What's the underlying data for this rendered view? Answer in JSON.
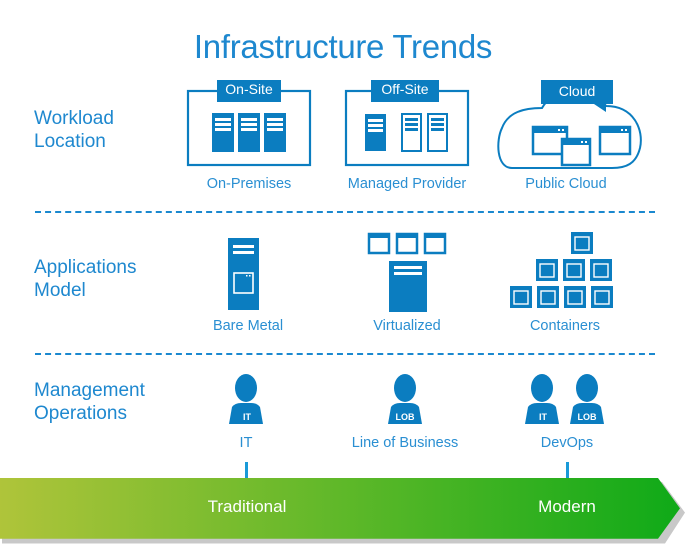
{
  "title": "Infrastructure Trends",
  "colors": {
    "primary": "#0b7dc0",
    "text": "#1e88cf",
    "gradient_start": "#afc43a",
    "gradient_end": "#0faa18",
    "shadow": "#c8c8c8"
  },
  "rows": [
    {
      "label_lines": [
        "Workload",
        "Location"
      ],
      "items": [
        {
          "tag": "On-Site",
          "caption": "On-Premises",
          "icon": "on-premises-servers-icon"
        },
        {
          "tag": "Off-Site",
          "caption": "Managed Provider",
          "icon": "managed-provider-servers-icon"
        },
        {
          "tag": "Cloud",
          "caption": "Public Cloud",
          "icon": "public-cloud-icon"
        }
      ]
    },
    {
      "label_lines": [
        "Applications",
        "Model"
      ],
      "items": [
        {
          "caption": "Bare Metal",
          "icon": "bare-metal-server-icon"
        },
        {
          "caption": "Virtualized",
          "icon": "virtualized-server-icon"
        },
        {
          "caption": "Containers",
          "icon": "containers-stack-icon"
        }
      ]
    },
    {
      "label_lines": [
        "Management",
        "Operations"
      ],
      "items": [
        {
          "caption": "IT",
          "badges": [
            "IT"
          ],
          "icon": "it-person-icon"
        },
        {
          "caption": "Line of Business",
          "badges": [
            "LOB"
          ],
          "icon": "lob-person-icon"
        },
        {
          "caption": "DevOps",
          "badges": [
            "IT",
            "LOB"
          ],
          "icon": "devops-people-icon"
        }
      ]
    }
  ],
  "timeline": {
    "start_label": "Traditional",
    "end_label": "Modern"
  }
}
